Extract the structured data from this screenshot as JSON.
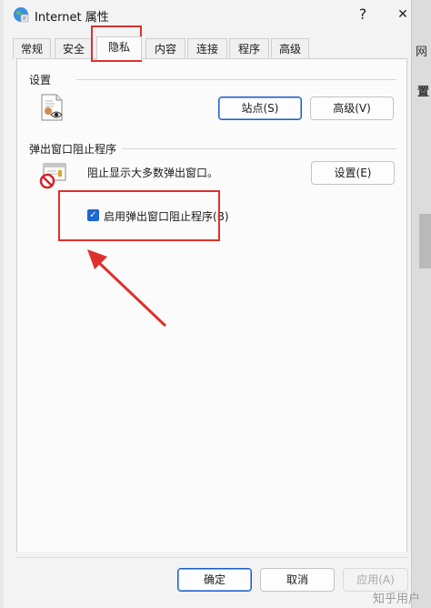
{
  "window": {
    "title": "Internet 属性",
    "help_label": "?",
    "close_label": "✕"
  },
  "tabs": [
    {
      "label": "常规"
    },
    {
      "label": "安全"
    },
    {
      "label": "隐私",
      "active": true
    },
    {
      "label": "内容"
    },
    {
      "label": "连接"
    },
    {
      "label": "程序"
    },
    {
      "label": "高级"
    }
  ],
  "settings": {
    "group_label": "设置",
    "icon": "privacy-page-icon",
    "sites_button": "站点(S)",
    "advanced_button": "高级(V)"
  },
  "popup": {
    "group_label": "弹出窗口阻止程序",
    "icon": "popup-block-icon",
    "description": "阻止显示大多数弹出窗口。",
    "settings_button": "设置(E)",
    "checkbox_label": "启用弹出窗口阻止程序(B)",
    "checkbox_checked": true
  },
  "footer": {
    "ok": "确定",
    "cancel": "取消",
    "apply": "应用(A)"
  },
  "watermark": "知乎用户",
  "background_fragments": [
    "网",
    "置"
  ],
  "colors": {
    "annotation": "#e0302c",
    "checkbox": "#1f67d2",
    "default_button_border": "#1b5fc7"
  }
}
